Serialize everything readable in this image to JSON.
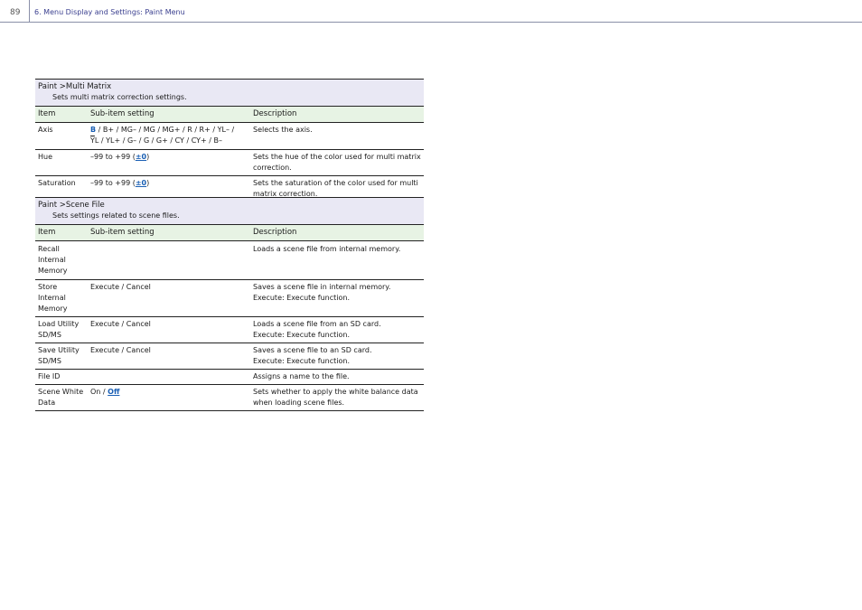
{
  "header": {
    "page_number": "89",
    "title": "6. Menu Display and Settings: Paint Menu"
  },
  "columns": {
    "item": "Item",
    "sub_item": "Sub-item setting",
    "description": "Description"
  },
  "multi_matrix": {
    "title": "Paint >Multi Matrix",
    "description": "Sets multi matrix correction settings.",
    "rows": {
      "axis": {
        "item": "Axis",
        "sub_default": "B",
        "sub_line1": " / B+ / MG– / MG / MG+ / R / R+ / YL– /",
        "sub_line2_over": "Y",
        "sub_line2": "L / YL+ / G– / G / G+ / CY / CY+ / B–",
        "description": "Selects the axis."
      },
      "hue": {
        "item": "Hue",
        "sub_prefix": "–99 to +99 (",
        "sub_default": "±0",
        "sub_suffix": ")",
        "description": "Sets the hue of the color used for multi matrix correction."
      },
      "saturation": {
        "item": "Saturation",
        "sub_prefix": "–99 to +99 (",
        "sub_default": "±0",
        "sub_suffix": ")",
        "description": "Sets the saturation of the color used for multi matrix correction."
      }
    }
  },
  "scene_file": {
    "title": "Paint >Scene File",
    "description": "Sets settings related to scene files.",
    "rows": {
      "recall": {
        "item_l1": "Recall",
        "item_l2": "Internal",
        "item_l3": "Memory",
        "sub": "",
        "description": "Loads a scene file from internal memory."
      },
      "store": {
        "item_l1": "Store Internal",
        "item_l2": "Memory",
        "sub": "Execute / Cancel",
        "desc_l1": "Saves a scene file in internal memory.",
        "desc_l2": "Execute: Execute function."
      },
      "load": {
        "item_l1": "Load Utility",
        "item_l2": "SD/MS",
        "sub": "Execute / Cancel",
        "desc_l1": "Loads a scene file from an SD card.",
        "desc_l2": "Execute: Execute function."
      },
      "save": {
        "item_l1": "Save Utility",
        "item_l2": "SD/MS",
        "sub": "Execute / Cancel",
        "desc_l1": "Saves a scene file to an SD card.",
        "desc_l2": "Execute: Execute function."
      },
      "file_id": {
        "item": "File ID",
        "sub": "",
        "description": "Assigns a name to the file."
      },
      "white_data": {
        "item_l1": "Scene White",
        "item_l2": "Data",
        "sub_prefix": "On / ",
        "sub_default": "Off",
        "description": "Sets whether to apply the white balance data when loading scene files."
      }
    }
  }
}
